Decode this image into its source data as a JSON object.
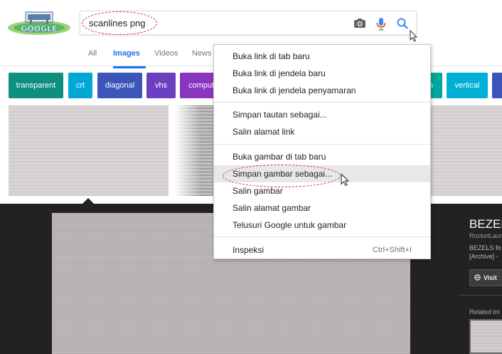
{
  "header": {
    "logo_text": "GOOGLE",
    "search": {
      "query": "scanlines png"
    },
    "tabs": [
      {
        "label": "All",
        "active": false
      },
      {
        "label": "Images",
        "active": true
      },
      {
        "label": "Videos",
        "active": false
      },
      {
        "label": "News",
        "active": false
      }
    ]
  },
  "chips": [
    {
      "label": "transparent",
      "color": "#0f8f80"
    },
    {
      "label": "crt",
      "color": "#00a8d6"
    },
    {
      "label": "diagonal",
      "color": "#3b55b8"
    },
    {
      "label": "vhs",
      "color": "#6a3fc0"
    },
    {
      "label": "computer",
      "color": "#8a34c0"
    },
    {
      "label": "n",
      "color": "#00a99d"
    },
    {
      "label": "vertical",
      "color": "#00b0d6"
    },
    {
      "label": "",
      "color": "#3b55b8"
    }
  ],
  "context_menu": {
    "groups": [
      [
        "Buka link di tab baru",
        "Buka link di jendela baru",
        "Buka link di jendela penyamaran"
      ],
      [
        "Simpan tautan sebagai...",
        "Salin alamat link"
      ],
      [
        "Buka gambar di tab baru",
        "Simpan gambar sebagai...",
        "Salin gambar",
        "Salin alamat gambar",
        "Telusuri Google untuk gambar"
      ],
      [
        "Inspeksi"
      ]
    ],
    "highlighted_item": "Simpan gambar sebagai...",
    "inspect_shortcut": "Ctrl+Shift+I"
  },
  "info_panel": {
    "title": "BEZELS",
    "site": "RocketLauncher",
    "description_line1": "BEZELS fo",
    "description_line2": "[Archive] -",
    "visit_label": "Visit",
    "related_label": "Related im"
  },
  "colors": {
    "accent": "#1a73e8",
    "annotation": "#d0273a",
    "panel": "#222222"
  }
}
